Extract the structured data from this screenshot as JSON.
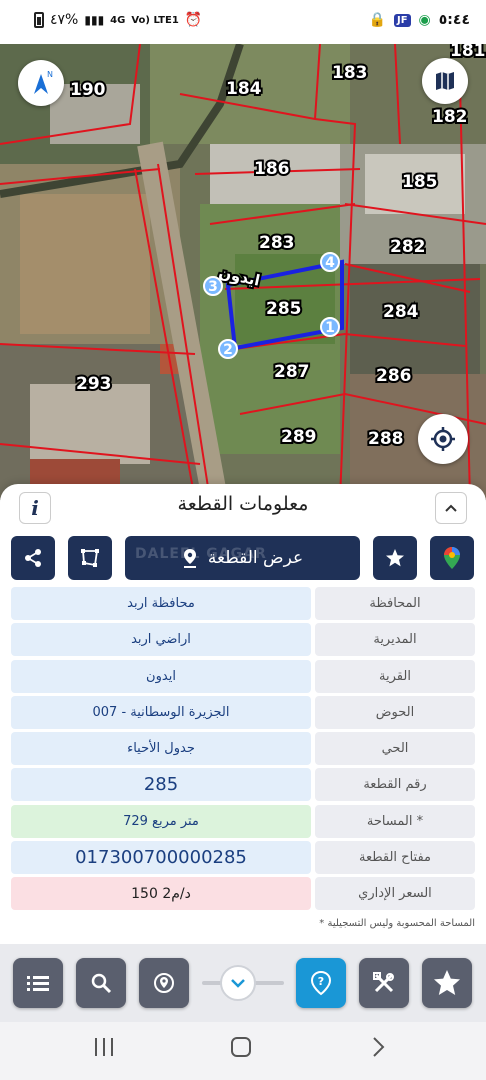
{
  "status_bar": {
    "battery": "٤٧%",
    "network": "4G",
    "volte": "Vo) LTE1",
    "time": "٥:٤٤",
    "jf_badge": "JF"
  },
  "map": {
    "parcels": [
      "181",
      "190",
      "183",
      "184",
      "182",
      "186",
      "185",
      "283",
      "282",
      "285",
      "284",
      "287",
      "286",
      "293",
      "289",
      "288"
    ],
    "vertex_labels": [
      "1",
      "2",
      "3",
      "4"
    ],
    "street_label": "ايدون",
    "compass_label": "N"
  },
  "sheet": {
    "title": "معلومات القطعة",
    "info_label": "i",
    "show_parcel_label": "عرض القطعة",
    "watermark": "DALEEL GAGAR",
    "rows": [
      {
        "label": "المحافظة",
        "value": "محافظة اربد"
      },
      {
        "label": "المديرية",
        "value": "اراضي اربد"
      },
      {
        "label": "القرية",
        "value": "ايدون"
      },
      {
        "label": "الحوض",
        "value": "الجزيرة الوسطانية - 007"
      },
      {
        "label": "الحي",
        "value": "جدول الأحياء"
      },
      {
        "label": "رقم القطعة",
        "value": "285"
      },
      {
        "label": "المساحة *",
        "value": "729  متر مربع"
      },
      {
        "label": "مفتاح القطعة",
        "value": "017300700000285"
      },
      {
        "label": "السعر الإداري",
        "value": "150 د/م2"
      }
    ],
    "footnote": "* المساحة المحسوبة وليس التسجيلية"
  },
  "colors": {
    "navy": "#1f3157",
    "accent": "#1a97d6",
    "parcel_outline": "#1a22e0",
    "parcel_lines": "#e0141e"
  },
  "icons": {
    "share": "share-icon",
    "polygon": "polygon-icon",
    "location": "map-pin-icon",
    "star": "star-icon",
    "maps": "google-maps-icon",
    "list": "list-icon",
    "search": "search-icon",
    "pin_search": "location-search-icon",
    "chevron": "chevron-down-icon",
    "help": "help-pin-icon",
    "tools": "tools-icon",
    "favorites": "favorites-star-icon"
  }
}
